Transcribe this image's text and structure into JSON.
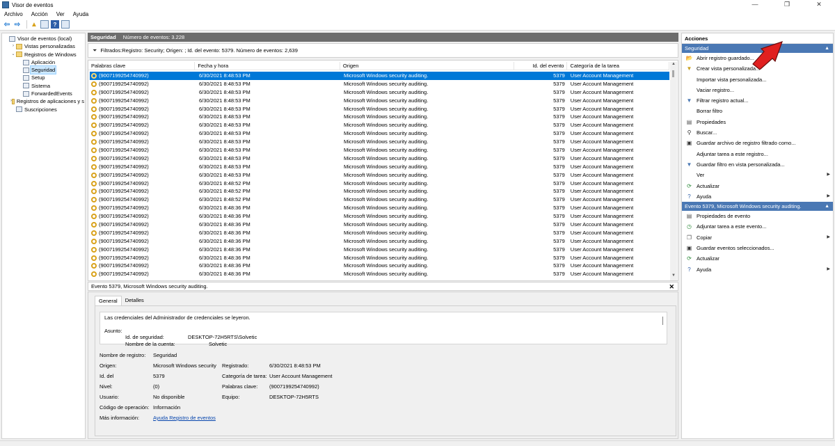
{
  "window": {
    "title": "Visor de eventos",
    "controls": [
      "—",
      "❐",
      "✕"
    ]
  },
  "menu": [
    "Archivo",
    "Acción",
    "Ver",
    "Ayuda"
  ],
  "tree": [
    {
      "label": "Visor de eventos (local)",
      "level": 0,
      "expander": ""
    },
    {
      "label": "Vistas personalizadas",
      "level": 1,
      "expander": "›"
    },
    {
      "label": "Registros de Windows",
      "level": 1,
      "expander": "⌄"
    },
    {
      "label": "Aplicación",
      "level": 2,
      "expander": ""
    },
    {
      "label": "Seguridad",
      "level": 2,
      "expander": "",
      "selected": true
    },
    {
      "label": "Setup",
      "level": 2,
      "expander": ""
    },
    {
      "label": "Sistema",
      "level": 2,
      "expander": ""
    },
    {
      "label": "ForwardedEvents",
      "level": 2,
      "expander": ""
    },
    {
      "label": "Registros de aplicaciones y s",
      "level": 1,
      "expander": "›"
    },
    {
      "label": "Suscripciones",
      "level": 1,
      "expander": ""
    }
  ],
  "center": {
    "title": "Seguridad",
    "event_count": "Número de eventos: 3.228",
    "filter": "Filtrados:Registro: Security; Origen: ; Id. del evento: 5379. Número de eventos: 2,639"
  },
  "table": {
    "columns": [
      "Palabras clave",
      "Fecha y hora",
      "Origen",
      "Id. del evento",
      "Categoría de la tarea"
    ],
    "rows": [
      [
        "(9007199254740992)",
        "6/30/2021 8:48:53 PM",
        "Microsoft Windows security auditing.",
        "5379",
        "User Account Management"
      ],
      [
        "(9007199254740992)",
        "6/30/2021 8:48:53 PM",
        "Microsoft Windows security auditing.",
        "5379",
        "User Account Management"
      ],
      [
        "(9007199254740992)",
        "6/30/2021 8:48:53 PM",
        "Microsoft Windows security auditing.",
        "5379",
        "User Account Management"
      ],
      [
        "(9007199254740992)",
        "6/30/2021 8:48:53 PM",
        "Microsoft Windows security auditing.",
        "5379",
        "User Account Management"
      ],
      [
        "(9007199254740992)",
        "6/30/2021 8:48:53 PM",
        "Microsoft Windows security auditing.",
        "5379",
        "User Account Management"
      ],
      [
        "(9007199254740992)",
        "6/30/2021 8:48:53 PM",
        "Microsoft Windows security auditing.",
        "5379",
        "User Account Management"
      ],
      [
        "(9007199254740992)",
        "6/30/2021 8:48:53 PM",
        "Microsoft Windows security auditing.",
        "5379",
        "User Account Management"
      ],
      [
        "(9007199254740992)",
        "6/30/2021 8:48:53 PM",
        "Microsoft Windows security auditing.",
        "5379",
        "User Account Management"
      ],
      [
        "(9007199254740992)",
        "6/30/2021 8:48:53 PM",
        "Microsoft Windows security auditing.",
        "5379",
        "User Account Management"
      ],
      [
        "(9007199254740992)",
        "6/30/2021 8:48:53 PM",
        "Microsoft Windows security auditing.",
        "5379",
        "User Account Management"
      ],
      [
        "(9007199254740992)",
        "6/30/2021 8:48:53 PM",
        "Microsoft Windows security auditing.",
        "5379",
        "User Account Management"
      ],
      [
        "(9007199254740992)",
        "6/30/2021 8:48:53 PM",
        "Microsoft Windows security auditing.",
        "5379",
        "User Account Management"
      ],
      [
        "(9007199254740992)",
        "6/30/2021 8:48:53 PM",
        "Microsoft Windows security auditing.",
        "5379",
        "User Account Management"
      ],
      [
        "(9007199254740992)",
        "6/30/2021 8:48:52 PM",
        "Microsoft Windows security auditing.",
        "5379",
        "User Account Management"
      ],
      [
        "(9007199254740992)",
        "6/30/2021 8:48:52 PM",
        "Microsoft Windows security auditing.",
        "5379",
        "User Account Management"
      ],
      [
        "(9007199254740992)",
        "6/30/2021 8:48:52 PM",
        "Microsoft Windows security auditing.",
        "5379",
        "User Account Management"
      ],
      [
        "(9007199254740992)",
        "6/30/2021 8:48:36 PM",
        "Microsoft Windows security auditing.",
        "5379",
        "User Account Management"
      ],
      [
        "(9007199254740992)",
        "6/30/2021 8:48:36 PM",
        "Microsoft Windows security auditing.",
        "5379",
        "User Account Management"
      ],
      [
        "(9007199254740992)",
        "6/30/2021 8:48:36 PM",
        "Microsoft Windows security auditing.",
        "5379",
        "User Account Management"
      ],
      [
        "(9007199254740992)",
        "6/30/2021 8:48:36 PM",
        "Microsoft Windows security auditing.",
        "5379",
        "User Account Management"
      ],
      [
        "(9007199254740992)",
        "6/30/2021 8:48:36 PM",
        "Microsoft Windows security auditing.",
        "5379",
        "User Account Management"
      ],
      [
        "(9007199254740992)",
        "6/30/2021 8:48:36 PM",
        "Microsoft Windows security auditing.",
        "5379",
        "User Account Management"
      ],
      [
        "(9007199254740992)",
        "6/30/2021 8:48:36 PM",
        "Microsoft Windows security auditing.",
        "5379",
        "User Account Management"
      ],
      [
        "(9007199254740992)",
        "6/30/2021 8:48:36 PM",
        "Microsoft Windows security auditing.",
        "5379",
        "User Account Management"
      ],
      [
        "(9007199254740992)",
        "6/30/2021 8:48:36 PM",
        "Microsoft Windows security auditing.",
        "5379",
        "User Account Management"
      ]
    ]
  },
  "detail": {
    "title": "Evento 5379, Microsoft Windows security auditing.",
    "tabs": [
      "General",
      "Detalles"
    ],
    "message": {
      "line1": "Las credenciales del Administrador de credenciales se leyeron.",
      "subject_label": "Asunto:",
      "security_id_label": "Id. de seguridad:",
      "security_id_value": "DESKTOP-72H5RTS\\Solvetic",
      "account_name_label": "Nombre de la cuenta:",
      "account_name_value": "Solvetic"
    },
    "props": {
      "log_name_label": "Nombre de registro:",
      "log_name": "Seguridad",
      "source_label": "Origen:",
      "source": "Microsoft Windows security",
      "logged_label": "Registrado:",
      "logged": "6/30/2021 8:48:53 PM",
      "event_id_label": "Id. del",
      "event_id": "5379",
      "task_category_label": "Categoría de tarea:",
      "task_category": "User Account Management",
      "level_label": "Nivel:",
      "level": "(0)",
      "keywords_label": "Palabras clave:",
      "keywords": "(9007199254740992)",
      "user_label": "Usuario:",
      "user": "No disponible",
      "computer_label": "Equipo:",
      "computer": "DESKTOP-72H5RTS",
      "opcode_label": "Código de operación:",
      "opcode": "Información",
      "more_info_label": "Más información:",
      "more_info_link": "Ayuda Registro de eventos"
    }
  },
  "actions": {
    "title": "Acciones",
    "section1": "Seguridad",
    "items1": [
      {
        "label": "Abrir registro guardado...",
        "icon": "open-log-icon",
        "glyph": "📂",
        "color": "#d9a21b"
      },
      {
        "label": "Crear vista personalizada...",
        "icon": "filter-new-icon",
        "glyph": "▼",
        "color": "#c8a020"
      },
      {
        "label": "Importar vista personalizada...",
        "icon": "",
        "glyph": "",
        "color": ""
      },
      {
        "label": "Vaciar registro...",
        "icon": "",
        "glyph": "",
        "color": ""
      },
      {
        "label": "Filtrar registro actual...",
        "icon": "filter-icon",
        "glyph": "▼",
        "color": "#4a78b4"
      },
      {
        "label": "Borrar filtro",
        "icon": "",
        "glyph": "",
        "color": ""
      },
      {
        "label": "Propiedades",
        "icon": "properties-icon",
        "glyph": "▤",
        "color": "#555"
      },
      {
        "label": "Buscar...",
        "icon": "find-icon",
        "glyph": "⚲",
        "color": "#333"
      },
      {
        "label": "Guardar archivo de registro filtrado como...",
        "icon": "save-icon",
        "glyph": "▣",
        "color": "#333"
      },
      {
        "label": "Adjuntar tarea a este registro...",
        "icon": "",
        "glyph": "",
        "color": ""
      },
      {
        "label": "Guardar filtro en vista personalizada...",
        "icon": "save-filter-icon",
        "glyph": "▼",
        "color": "#4a78b4"
      },
      {
        "label": "Ver",
        "icon": "",
        "glyph": "",
        "color": "",
        "submenu": true
      },
      {
        "label": "Actualizar",
        "icon": "refresh-icon",
        "glyph": "⟳",
        "color": "#2e8b3a"
      },
      {
        "label": "Ayuda",
        "icon": "help-icon",
        "glyph": "?",
        "color": "#2f5fa8",
        "submenu": true
      }
    ],
    "section2": "Evento 5379, Microsoft Windows security auditing.",
    "items2": [
      {
        "label": "Propiedades de evento",
        "icon": "event-properties-icon",
        "glyph": "▤",
        "color": "#555"
      },
      {
        "label": "Adjuntar tarea a este evento...",
        "icon": "attach-task-icon",
        "glyph": "◷",
        "color": "#2e8b3a"
      },
      {
        "label": "Copiar",
        "icon": "copy-icon",
        "glyph": "❐",
        "color": "#555",
        "submenu": true
      },
      {
        "label": "Guardar eventos seleccionados...",
        "icon": "save-icon",
        "glyph": "▣",
        "color": "#333"
      },
      {
        "label": "Actualizar",
        "icon": "refresh-icon",
        "glyph": "⟳",
        "color": "#2e8b3a"
      },
      {
        "label": "Ayuda",
        "icon": "help-icon",
        "glyph": "?",
        "color": "#2f5fa8",
        "submenu": true
      }
    ]
  }
}
